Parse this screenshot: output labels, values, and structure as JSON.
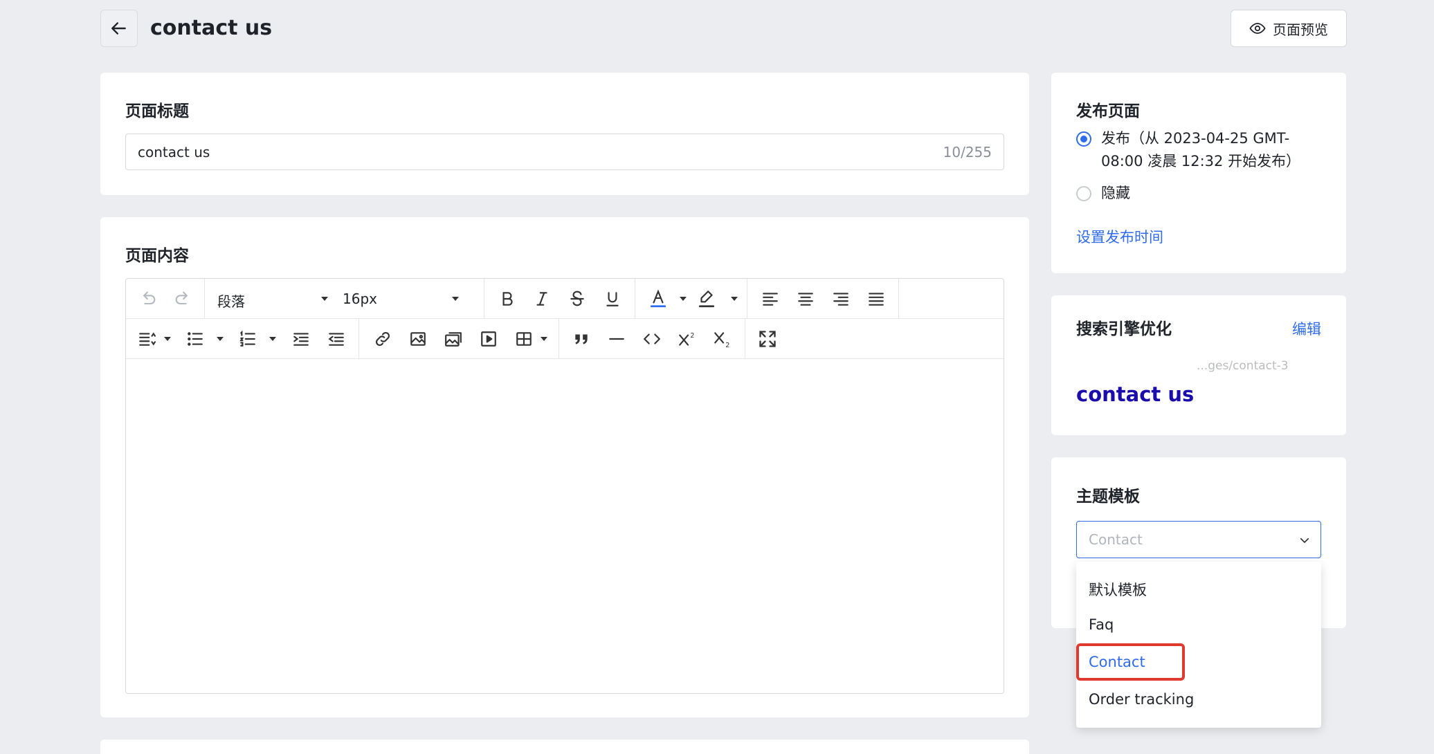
{
  "header": {
    "title": "contact us",
    "preview_label": "页面预览"
  },
  "title_card": {
    "label": "页面标题",
    "input_value": "contact us",
    "char_count": "10/255"
  },
  "content_card": {
    "label": "页面内容",
    "toolbar": {
      "paragraph_select": "段落",
      "font_size_select": "16px",
      "row1_icons": [
        "undo-icon",
        "redo-icon",
        "bold-icon",
        "italic-icon",
        "strikethrough-icon",
        "underline-icon",
        "font-color-icon",
        "highlight-icon",
        "align-left-icon",
        "align-center-icon",
        "align-right-icon",
        "align-justify-icon"
      ],
      "row2_icons": [
        "line-height-icon",
        "bullet-list-icon",
        "numbered-list-icon",
        "indent-icon",
        "outdent-icon",
        "link-icon",
        "image-icon",
        "gallery-icon",
        "video-icon",
        "table-icon",
        "quote-icon",
        "horizontal-rule-icon",
        "code-icon",
        "superscript-icon",
        "subscript-icon",
        "fullscreen-icon"
      ]
    }
  },
  "publish_card": {
    "label": "发布页面",
    "option_publish_line1": "发布（从 2023-04-25 GMT-",
    "option_publish_line2": "08:00 凌晨 12:32 开始发布）",
    "option_hide": "隐藏",
    "set_time_link": "设置发布时间"
  },
  "seo_card": {
    "label": "搜索引擎优化",
    "edit_link": "编辑",
    "url_snippet": "...ges/contact-3",
    "seo_title": "contact us"
  },
  "theme_card": {
    "label": "主题模板",
    "select_placeholder": "Contact",
    "options": [
      "默认模板",
      "Faq",
      "Contact",
      "Order tracking"
    ],
    "selected": "Contact"
  },
  "colors": {
    "accent": "#2f6bed",
    "highlight_box": "#e03a2e",
    "seo_title": "#1a0dab",
    "background": "#ebedf0"
  }
}
